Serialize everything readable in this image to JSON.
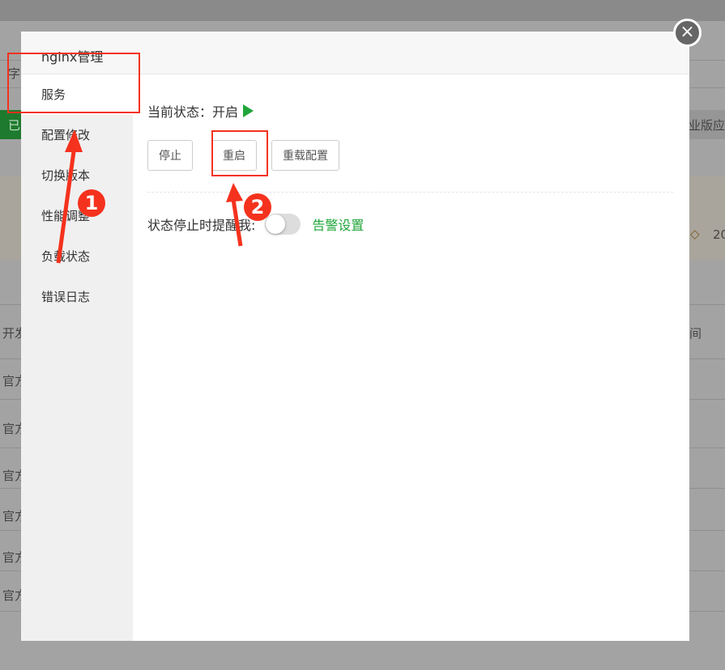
{
  "background": {
    "search_frag": "字",
    "installed_frag": "已",
    "pro_frag": "企业版应",
    "count_frag": "20",
    "col_dev": "开发",
    "col_time": "间",
    "row_frag": "官方"
  },
  "modal": {
    "title": "nginx管理",
    "sidebar": [
      "服务",
      "配置修改",
      "切换版本",
      "性能调整",
      "负载状态",
      "错误日志"
    ],
    "status_label": "当前状态：",
    "status_value": "开启",
    "buttons": {
      "stop": "停止",
      "restart": "重启",
      "reload": "重载配置"
    },
    "alert_label": "状态停止时提醒我:",
    "alert_toggle_on": false,
    "alert_link": "告警设置",
    "close": "×"
  },
  "annotations": {
    "badge1": "1",
    "badge2": "2",
    "color": "#f4321e"
  }
}
